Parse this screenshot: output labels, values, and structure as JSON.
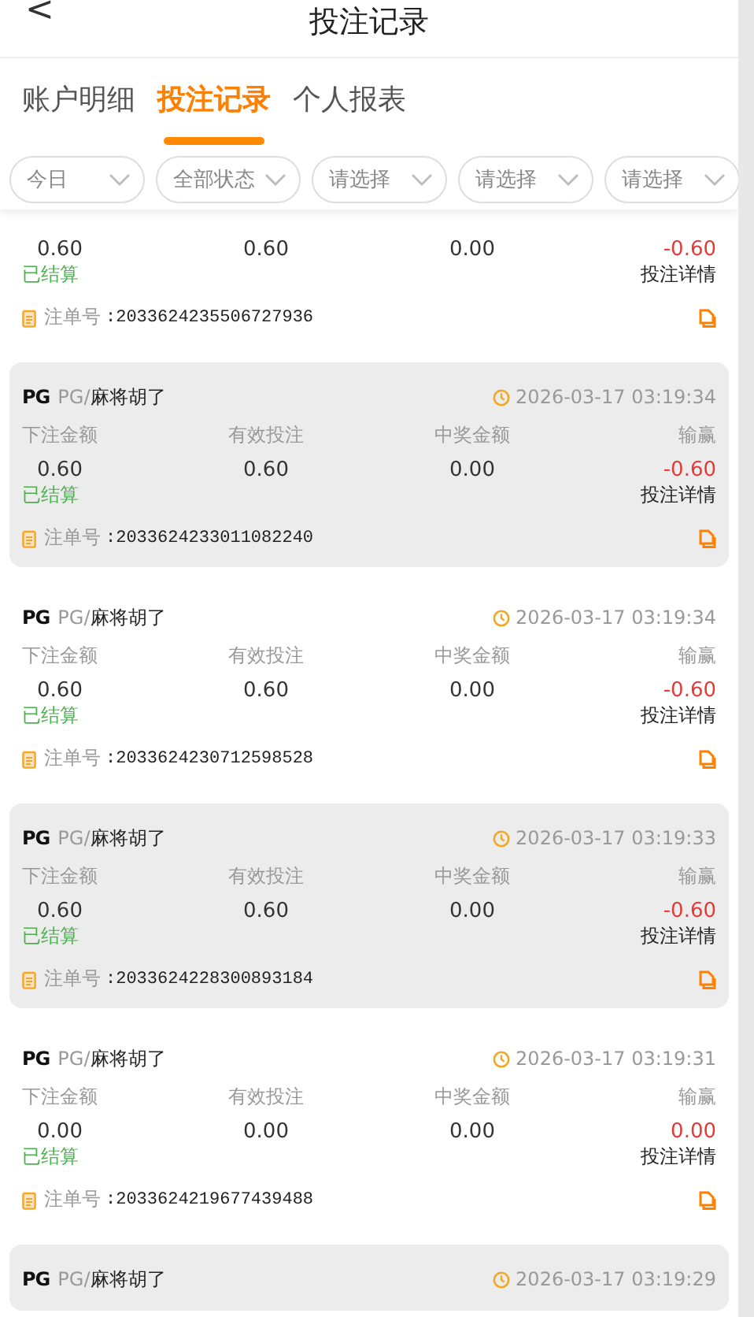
{
  "header": {
    "back": "<",
    "title": "投注记录"
  },
  "tabs": [
    {
      "label": "账户明细",
      "selected": false
    },
    {
      "label": "投注记录",
      "selected": true
    },
    {
      "label": "个人报表",
      "selected": false
    }
  ],
  "filters": [
    {
      "value": "今日"
    },
    {
      "value": "全部状态"
    },
    {
      "value": "请选择"
    },
    {
      "value": "请选择"
    },
    {
      "value": "请选择"
    }
  ],
  "records": [
    {
      "kind": "partial_top",
      "values": [
        "0.60",
        "0.60",
        "0.00",
        "-0.60"
      ],
      "status": "已结算",
      "detail": "投注详情",
      "order_label": "注单号",
      "order_no": ":2033624235506727936"
    },
    {
      "kind": "full",
      "logo": "PG",
      "provider": "PG",
      "separator": "/",
      "game": "麻将胡了",
      "time": "2026-03-17 03:19:34",
      "labels": [
        "下注金额",
        "有效投注",
        "中奖金额",
        "输赢"
      ],
      "values": [
        "0.60",
        "0.60",
        "0.00",
        "-0.60"
      ],
      "status": "已结算",
      "detail": "投注详情",
      "order_label": "注单号",
      "order_no": ":2033624233011082240"
    },
    {
      "kind": "full",
      "logo": "PG",
      "provider": "PG",
      "separator": "/",
      "game": "麻将胡了",
      "time": "2026-03-17 03:19:34",
      "labels": [
        "下注金额",
        "有效投注",
        "中奖金额",
        "输赢"
      ],
      "values": [
        "0.60",
        "0.60",
        "0.00",
        "-0.60"
      ],
      "status": "已结算",
      "detail": "投注详情",
      "order_label": "注单号",
      "order_no": ":2033624230712598528"
    },
    {
      "kind": "full",
      "logo": "PG",
      "provider": "PG",
      "separator": "/",
      "game": "麻将胡了",
      "time": "2026-03-17 03:19:33",
      "labels": [
        "下注金额",
        "有效投注",
        "中奖金额",
        "输赢"
      ],
      "values": [
        "0.60",
        "0.60",
        "0.00",
        "-0.60"
      ],
      "status": "已结算",
      "detail": "投注详情",
      "order_label": "注单号",
      "order_no": ":2033624228300893184"
    },
    {
      "kind": "full",
      "logo": "PG",
      "provider": "PG",
      "separator": "/",
      "game": "麻将胡了",
      "time": "2026-03-17 03:19:31",
      "labels": [
        "下注金额",
        "有效投注",
        "中奖金额",
        "输赢"
      ],
      "values": [
        "0.00",
        "0.00",
        "0.00",
        "0.00"
      ],
      "status": "已结算",
      "detail": "投注详情",
      "order_label": "注单号",
      "order_no": ":2033624219677439488"
    },
    {
      "kind": "partial_bottom",
      "logo": "PG",
      "provider": "PG",
      "separator": "/",
      "game": "麻将胡了",
      "time": "2026-03-17 03:19:29"
    }
  ]
}
